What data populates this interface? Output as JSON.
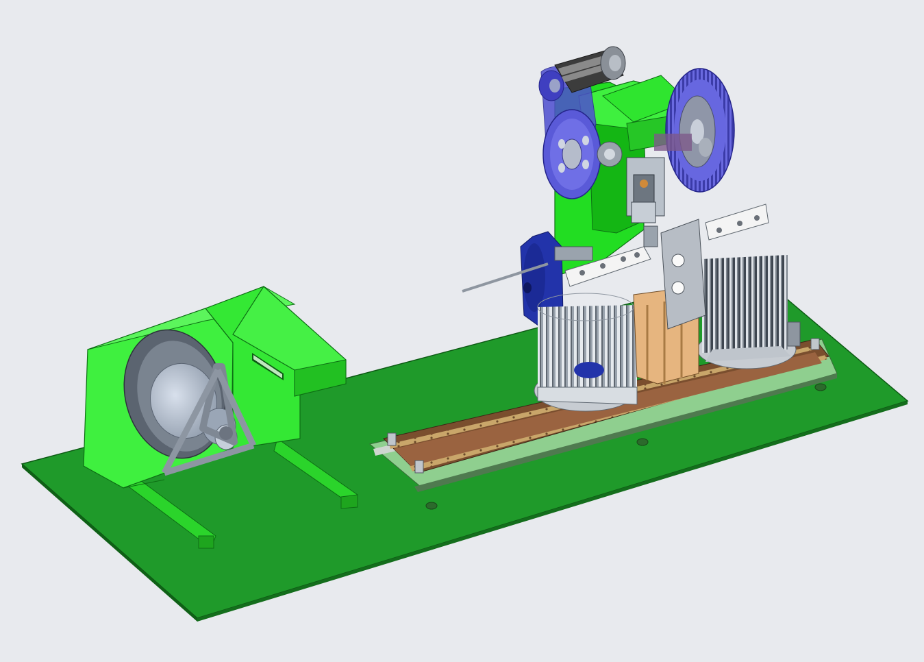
{
  "scene": {
    "type": "3d-cad-render",
    "colors": {
      "background": "#e8eaee",
      "base_plate": "#1f9a2a",
      "frame_green": "#33e633",
      "flywheel_blue": "#5a5ad8",
      "motor_dark": "#3c3c3c",
      "steel": "#b8bfc8",
      "rail_brown": "#8a5a3a",
      "wood": "#e0b080",
      "rotor_blue": "#2233aa"
    },
    "components": [
      {
        "name": "base-plate",
        "color": "base_plate"
      },
      {
        "name": "coil-decoiler",
        "color": "frame_green"
      },
      {
        "name": "wire-reel",
        "color": "steel"
      },
      {
        "name": "power-press-frame",
        "color": "frame_green"
      },
      {
        "name": "drive-motor",
        "color": "motor_dark"
      },
      {
        "name": "flywheel",
        "color": "flywheel_blue"
      },
      {
        "name": "gear-wheel",
        "color": "flywheel_blue"
      },
      {
        "name": "linear-rail",
        "color": "rail_brown"
      },
      {
        "name": "rod-magazine-left",
        "color": "steel"
      },
      {
        "name": "rod-magazine-right",
        "color": "steel"
      },
      {
        "name": "transfer-beam",
        "color": "steel"
      },
      {
        "name": "servo-motor",
        "color": "rotor_blue"
      }
    ]
  }
}
